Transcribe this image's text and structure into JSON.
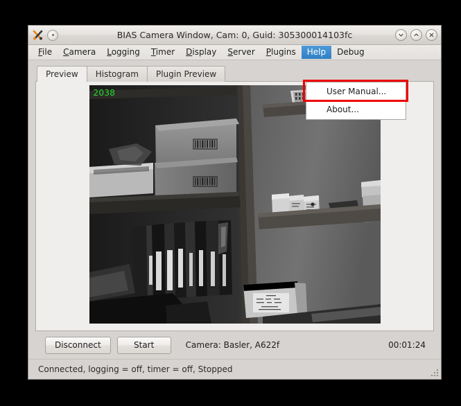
{
  "window": {
    "title": "BIAS Camera Window, Cam: 0, Guid: 305300014103fc",
    "icon_name": "bias-app-icon",
    "menu_dot_button": "window-menu-button",
    "controls": [
      {
        "name": "minimize-button",
        "glyph": "chevron-down"
      },
      {
        "name": "maximize-button",
        "glyph": "chevron-up"
      },
      {
        "name": "close-button",
        "glyph": "x"
      }
    ]
  },
  "menubar": {
    "items": [
      {
        "label": "File",
        "mnemonic": "F",
        "active": false
      },
      {
        "label": "Camera",
        "mnemonic": "C",
        "active": false
      },
      {
        "label": "Logging",
        "mnemonic": "L",
        "active": false
      },
      {
        "label": "Timer",
        "mnemonic": "T",
        "active": false
      },
      {
        "label": "Display",
        "mnemonic": "D",
        "active": false
      },
      {
        "label": "Server",
        "mnemonic": "S",
        "active": false
      },
      {
        "label": "Plugins",
        "mnemonic": "P",
        "active": false
      },
      {
        "label": "Help",
        "mnemonic": "H",
        "active": true
      },
      {
        "label": "Debug",
        "mnemonic": "",
        "active": false
      }
    ]
  },
  "help_menu": {
    "open": true,
    "items": [
      {
        "label": "User Manual...",
        "highlighted": true
      },
      {
        "label": "About...",
        "highlighted": false
      }
    ],
    "annotation_color": "#ee0000"
  },
  "tabs": [
    {
      "label": "Preview",
      "selected": true
    },
    {
      "label": "Histogram",
      "selected": false
    },
    {
      "label": "Plugin Preview",
      "selected": false
    }
  ],
  "preview": {
    "frame_number": "2038",
    "frame_number_color": "#22e02c"
  },
  "controls": {
    "disconnect_label": "Disconnect",
    "start_label": "Start",
    "camera_info": "Camera:  Basler,  A622f",
    "timer": "00:01:24"
  },
  "statusbar": {
    "text": "Connected, logging = off, timer = off, Stopped"
  }
}
